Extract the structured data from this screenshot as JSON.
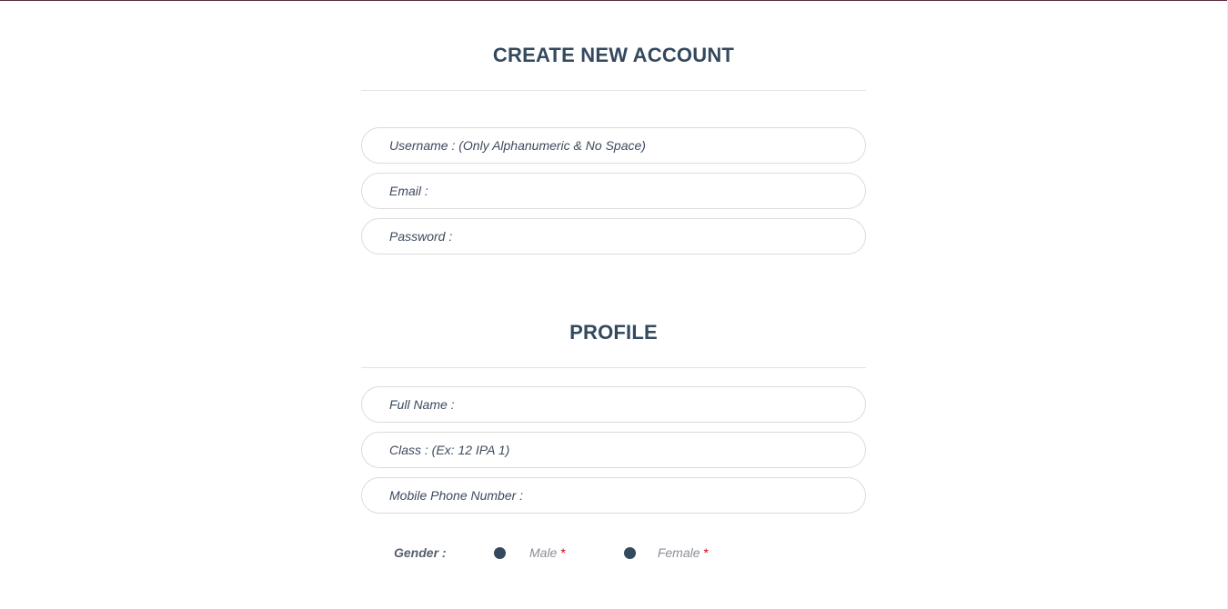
{
  "account": {
    "title": "CREATE NEW ACCOUNT",
    "fields": [
      {
        "name": "username-input",
        "placeholder": "Username : (Only Alphanumeric & No Space)",
        "value": ""
      },
      {
        "name": "email-input",
        "placeholder": "Email :",
        "value": ""
      },
      {
        "name": "password-input",
        "placeholder": "Password :",
        "value": ""
      }
    ]
  },
  "profile": {
    "title": "PROFILE",
    "fields": [
      {
        "name": "full-name-input",
        "placeholder": "Full Name :",
        "value": ""
      },
      {
        "name": "class-input",
        "placeholder": "Class : (Ex: 12 IPA 1)",
        "value": ""
      },
      {
        "name": "mobile-phone-input",
        "placeholder": "Mobile Phone Number :",
        "value": ""
      }
    ],
    "gender": {
      "label": "Gender :",
      "options": [
        {
          "label": "Male",
          "required_mark": "*"
        },
        {
          "label": "Female",
          "required_mark": "*"
        }
      ]
    }
  },
  "colors": {
    "heading": "#34495e",
    "radio": "#34495e",
    "required": "#d0021b",
    "top_rule": "#5a2a36"
  }
}
